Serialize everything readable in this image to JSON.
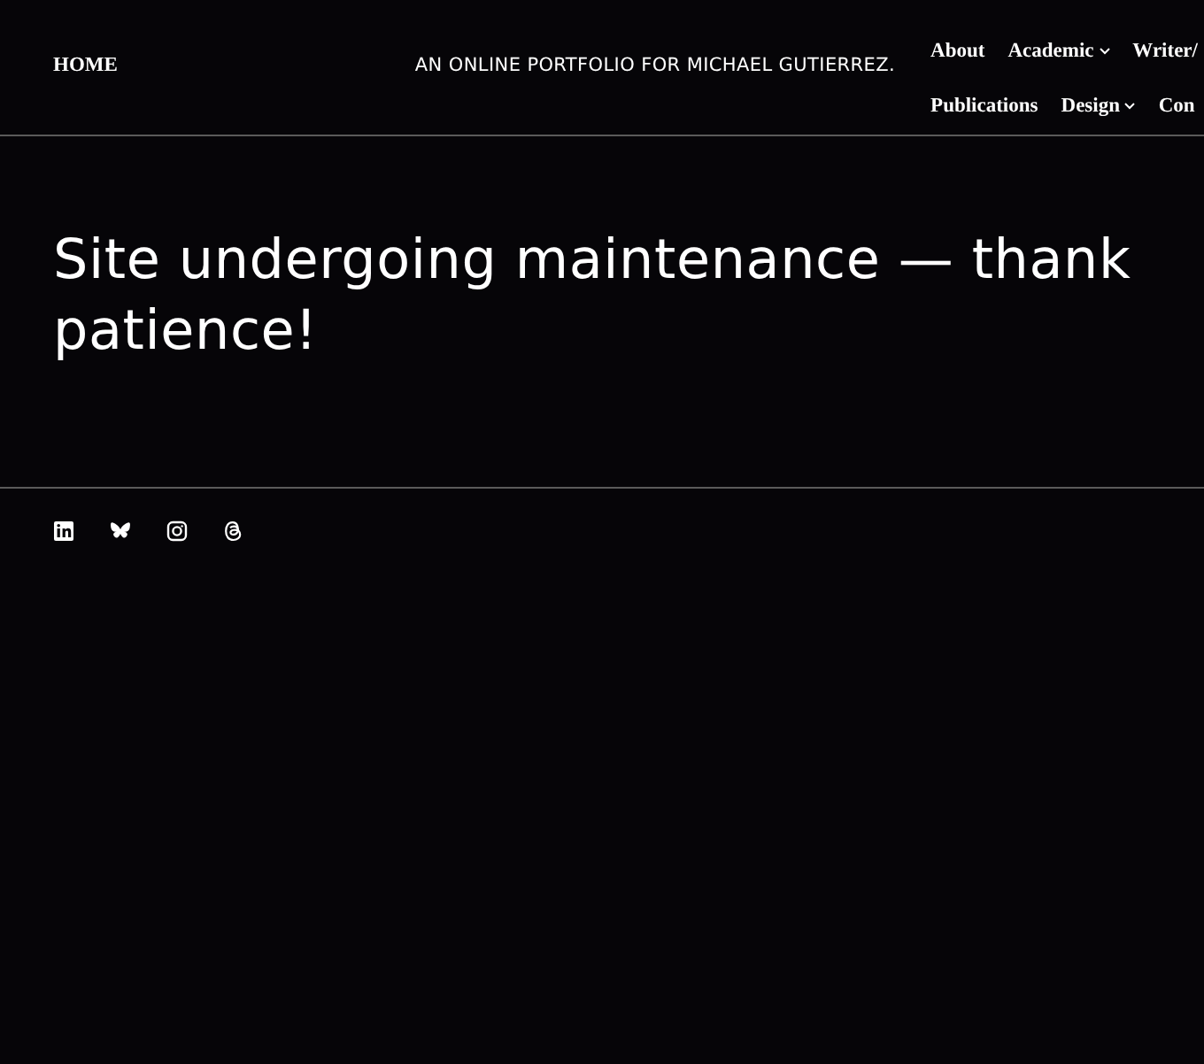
{
  "header": {
    "home_link": "HOME",
    "tagline": "AN ONLINE PORTFOLIO FOR MICHAEL GUTIERREZ.",
    "nav_rows": [
      [
        {
          "label": "About",
          "dropdown": false
        },
        {
          "label": "Academic",
          "dropdown": true
        },
        {
          "label": "Writer/",
          "dropdown": false
        }
      ],
      [
        {
          "label": "Publications",
          "dropdown": false
        },
        {
          "label": "Design",
          "dropdown": true
        },
        {
          "label": "Con",
          "dropdown": false
        }
      ]
    ]
  },
  "heading_lines": [
    "Site undergoing maintenance — thank",
    "patience!"
  ],
  "social_icons": [
    {
      "kind": "linkedin"
    },
    {
      "kind": "bluesky"
    },
    {
      "kind": "instagram"
    },
    {
      "kind": "threads"
    }
  ]
}
